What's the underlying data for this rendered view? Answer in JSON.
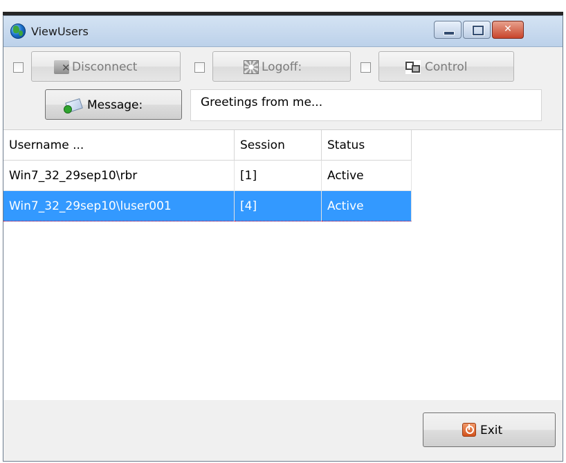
{
  "window": {
    "title": "ViewUsers"
  },
  "toolbar": {
    "disconnect_label": "Disconnect",
    "logoff_label": "Logoff:",
    "control_label": "Control"
  },
  "message": {
    "button_label": "Message:",
    "input_value": "Greetings from me..."
  },
  "sessions": {
    "columns": [
      "Username ...",
      "Session",
      "Status"
    ],
    "rows": [
      {
        "username": "Win7_32_29sep10\\rbr",
        "session": "[1]",
        "status": "Active",
        "selected": false
      },
      {
        "username": "Win7_32_29sep10\\luser001",
        "session": "[4]",
        "status": "Active",
        "selected": true
      }
    ]
  },
  "footer": {
    "exit_label": "Exit"
  },
  "colors": {
    "selection": "#3399ff",
    "titlebar": "#c6d9ef",
    "close_button": "#c8452c"
  }
}
